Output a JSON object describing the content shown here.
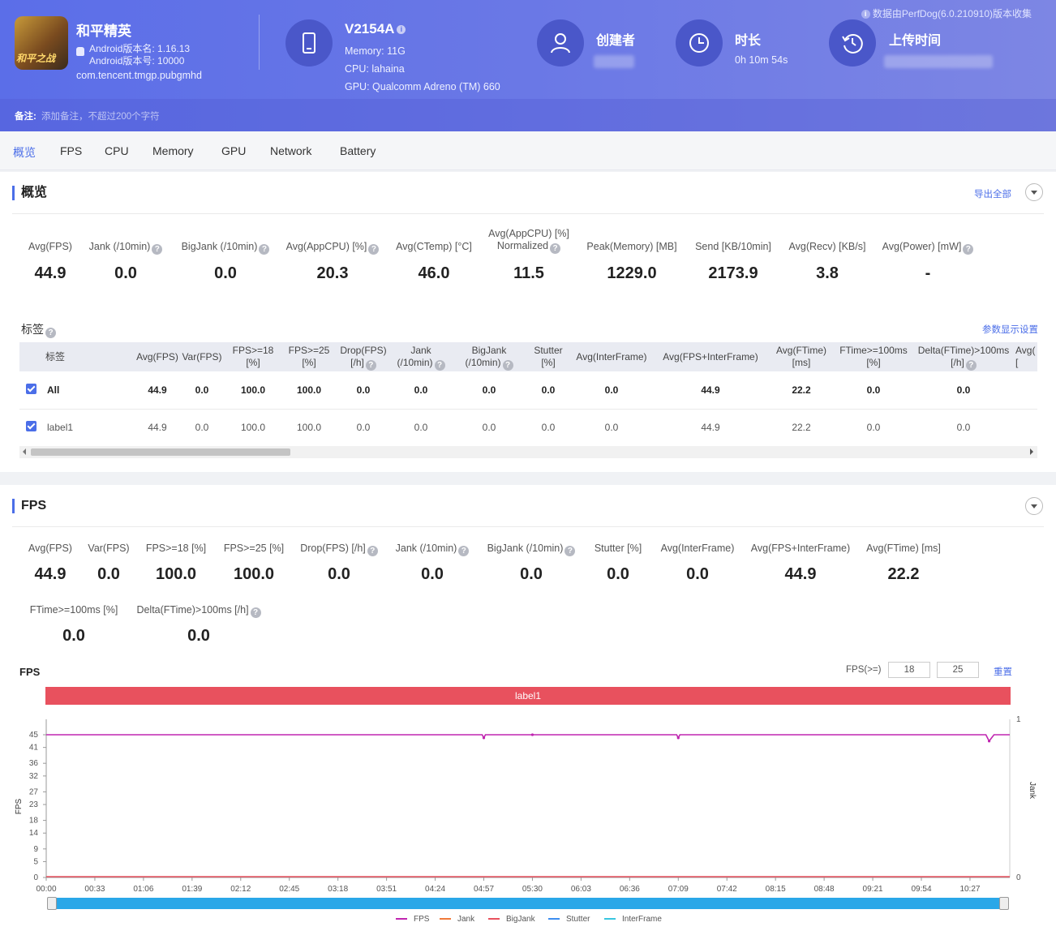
{
  "header": {
    "banner_note": "数据由PerfDog(6.0.210910)版本收集",
    "app_icon_text": "和平之战",
    "app_name": "和平精英",
    "android_version": "Android版本名: 1.16.13",
    "android_code": "Android版本号: 10000",
    "package": "com.tencent.tmgp.pubgmhd",
    "device_name": "V2154A",
    "memory": "Memory: 11G",
    "cpu": "CPU: lahaina",
    "gpu": "GPU: Qualcomm Adreno (TM) 660",
    "creator_title": "创建者",
    "duration_title": "时长",
    "duration_value": "0h 10m 54s",
    "upload_title": "上传时间",
    "remark_key": "备注:",
    "remark_placeholder": "添加备注，不超过200个字符"
  },
  "tabs": [
    "概览",
    "FPS",
    "CPU",
    "Memory",
    "GPU",
    "Network",
    "Battery"
  ],
  "overview": {
    "title": "概览",
    "export_label": "导出全部",
    "metrics": [
      {
        "label": "Avg(FPS)",
        "value": "44.9"
      },
      {
        "label": "Jank (/10min)",
        "value": "0.0"
      },
      {
        "label": "BigJank (/10min)",
        "value": "0.0"
      },
      {
        "label": "Avg(AppCPU) [%]",
        "value": "20.3"
      },
      {
        "label": "Avg(CTemp) [°C]",
        "value": "46.0"
      },
      {
        "label": "Avg(AppCPU) [%]",
        "label2": "Normalized",
        "value": "11.5"
      },
      {
        "label": "Peak(Memory) [MB]",
        "value": "1229.0"
      },
      {
        "label": "Send [KB/10min]",
        "value": "2173.9"
      },
      {
        "label": "Avg(Recv) [KB/s]",
        "value": "3.8"
      },
      {
        "label": "Avg(Power) [mW]",
        "value": "-"
      }
    ],
    "tags_title": "标签",
    "param_settings": "参数显示设置",
    "table": {
      "headers": [
        "标签",
        "Avg(FPS)",
        "Var(FPS)",
        "FPS>=18",
        "FPS>=25",
        "Drop(FPS)",
        "Jank",
        "BigJank",
        "Stutter",
        "Avg(InterFrame)",
        "Avg(FPS+InterFrame)",
        "Avg(FTime)",
        "FTime>=100ms",
        "Delta(FTime)>100ms",
        "Avg("
      ],
      "headers2": [
        "",
        "",
        "",
        "[%]",
        "[%]",
        "[/h]",
        "(/10min)",
        "(/10min)",
        "[%]",
        "",
        "",
        "[ms]",
        "[%]",
        "[/h]",
        "["
      ],
      "rows": [
        [
          "All",
          "44.9",
          "0.0",
          "100.0",
          "100.0",
          "0.0",
          "0.0",
          "0.0",
          "0.0",
          "0.0",
          "44.9",
          "22.2",
          "0.0",
          "0.0"
        ],
        [
          "label1",
          "44.9",
          "0.0",
          "100.0",
          "100.0",
          "0.0",
          "0.0",
          "0.0",
          "0.0",
          "0.0",
          "44.9",
          "22.2",
          "0.0",
          "0.0"
        ]
      ]
    }
  },
  "fps_section": {
    "title": "FPS",
    "metrics": [
      {
        "label": "Avg(FPS)",
        "value": "44.9"
      },
      {
        "label": "Var(FPS)",
        "value": "0.0"
      },
      {
        "label": "FPS>=18 [%]",
        "value": "100.0"
      },
      {
        "label": "FPS>=25 [%]",
        "value": "100.0"
      },
      {
        "label": "Drop(FPS) [/h]",
        "value": "0.0"
      },
      {
        "label": "Jank (/10min)",
        "value": "0.0"
      },
      {
        "label": "BigJank (/10min)",
        "value": "0.0"
      },
      {
        "label": "Stutter [%]",
        "value": "0.0"
      },
      {
        "label": "Avg(InterFrame)",
        "value": "0.0"
      },
      {
        "label": "Avg(FPS+InterFrame)",
        "value": "44.9"
      },
      {
        "label": "Avg(FTime) [ms]",
        "value": "22.2"
      },
      {
        "label": "FTime>=100ms [%]",
        "value": "0.0"
      },
      {
        "label": "Delta(FTime)>100ms [/h]",
        "value": "0.0"
      }
    ],
    "chart_title": "FPS",
    "threshold_label": "FPS(>=)",
    "threshold_1": "18",
    "threshold_2": "25",
    "reset_label": "重置",
    "label_bar": "label1"
  },
  "chart_data": {
    "type": "line",
    "ylabel": "FPS",
    "y2label": "Jank",
    "ylim": [
      0,
      45
    ],
    "y_ticks": [
      "45",
      "41",
      "36",
      "32",
      "27",
      "23",
      "18",
      "14",
      "9",
      "5",
      "0"
    ],
    "y2_ticks": [
      "1",
      "0"
    ],
    "x_ticks": [
      "00:00",
      "00:33",
      "01:06",
      "01:39",
      "02:12",
      "02:45",
      "03:18",
      "03:51",
      "04:24",
      "04:57",
      "05:30",
      "06:03",
      "06:36",
      "07:09",
      "07:42",
      "08:15",
      "08:48",
      "09:21",
      "09:54",
      "10:27"
    ],
    "series": [
      {
        "name": "FPS",
        "color": "#c026b0",
        "x": [
          "00:00",
          "04:57",
          "05:30",
          "07:09",
          "10:40",
          "10:54"
        ],
        "values": [
          45,
          44,
          45,
          44,
          43,
          45
        ]
      },
      {
        "name": "Jank",
        "color": "#f07a3a",
        "values": [
          0
        ]
      },
      {
        "name": "BigJank",
        "color": "#e8515e",
        "values": [
          0
        ]
      },
      {
        "name": "Stutter",
        "color": "#3d8ef0",
        "values": [
          0
        ]
      },
      {
        "name": "InterFrame",
        "color": "#38c6e0",
        "values": [
          0
        ]
      }
    ]
  }
}
